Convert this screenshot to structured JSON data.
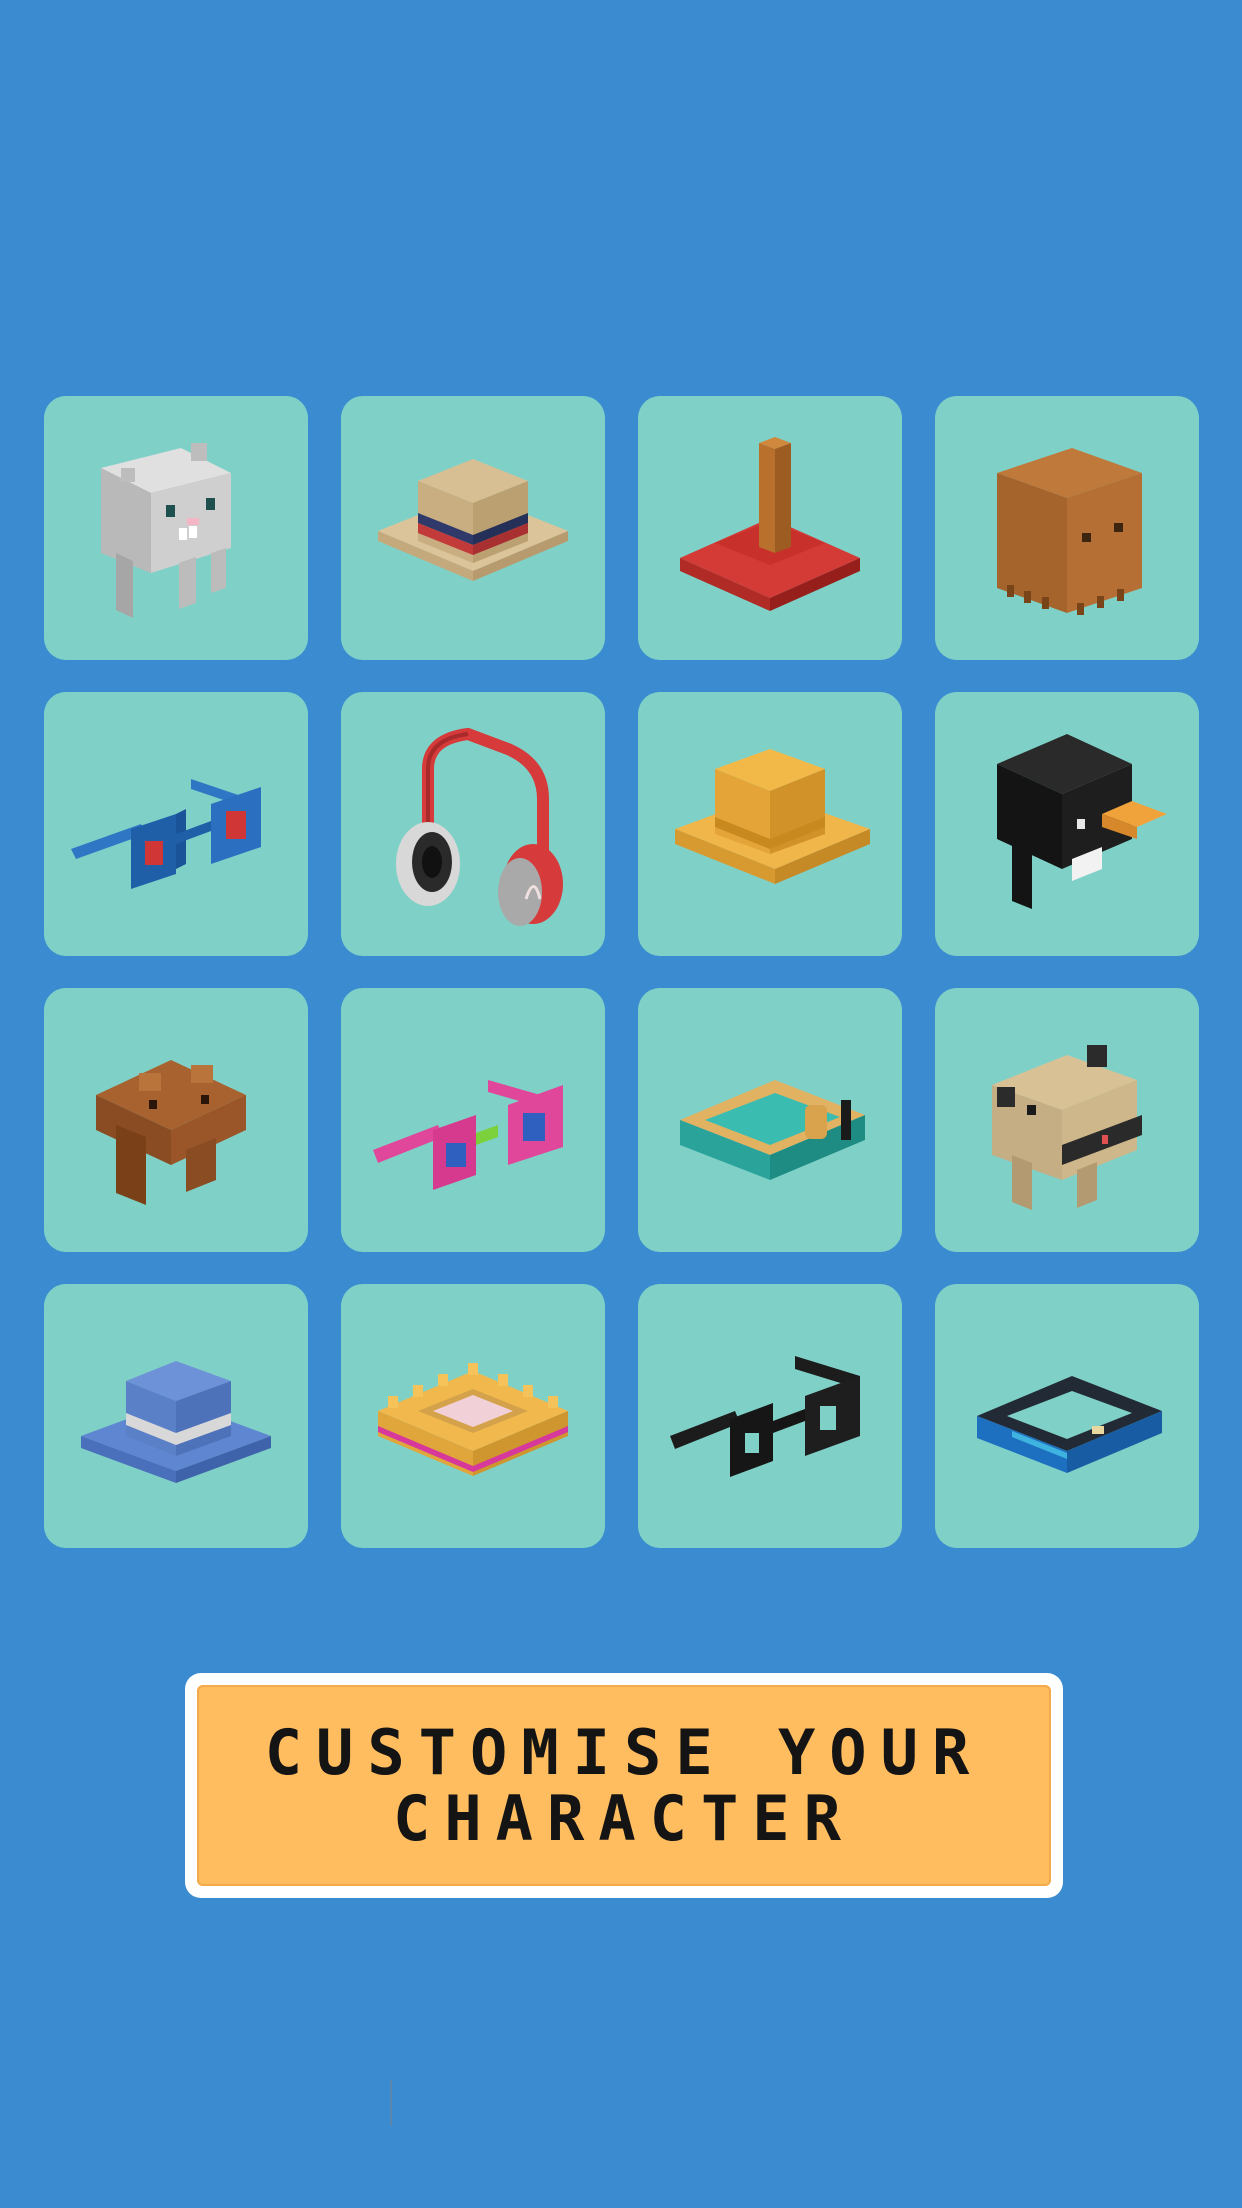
{
  "title_lines": [
    "CUSTOMISE YOUR",
    "CHARACTER"
  ],
  "colors": {
    "background": "#3a8bd0",
    "tile": "#7fd1c8",
    "banner_fill": "#ffbd5f",
    "banner_border": "#ffffff",
    "banner_text": "#141414"
  },
  "items": [
    {
      "name": "grey-hamster-head-icon"
    },
    {
      "name": "straw-boater-hat-icon"
    },
    {
      "name": "plunger-hat-icon"
    },
    {
      "name": "cardboard-box-head-icon"
    },
    {
      "name": "blue-glasses-icon"
    },
    {
      "name": "red-headphones-icon"
    },
    {
      "name": "yellow-hat-icon"
    },
    {
      "name": "penguin-head-icon"
    },
    {
      "name": "brown-bear-head-icon"
    },
    {
      "name": "pink-glasses-icon"
    },
    {
      "name": "teal-snorkel-mask-icon"
    },
    {
      "name": "pug-head-icon"
    },
    {
      "name": "blue-fedora-hat-icon"
    },
    {
      "name": "golden-crown-ring-icon"
    },
    {
      "name": "black-glasses-icon"
    },
    {
      "name": "black-snorkel-mask-icon"
    }
  ]
}
